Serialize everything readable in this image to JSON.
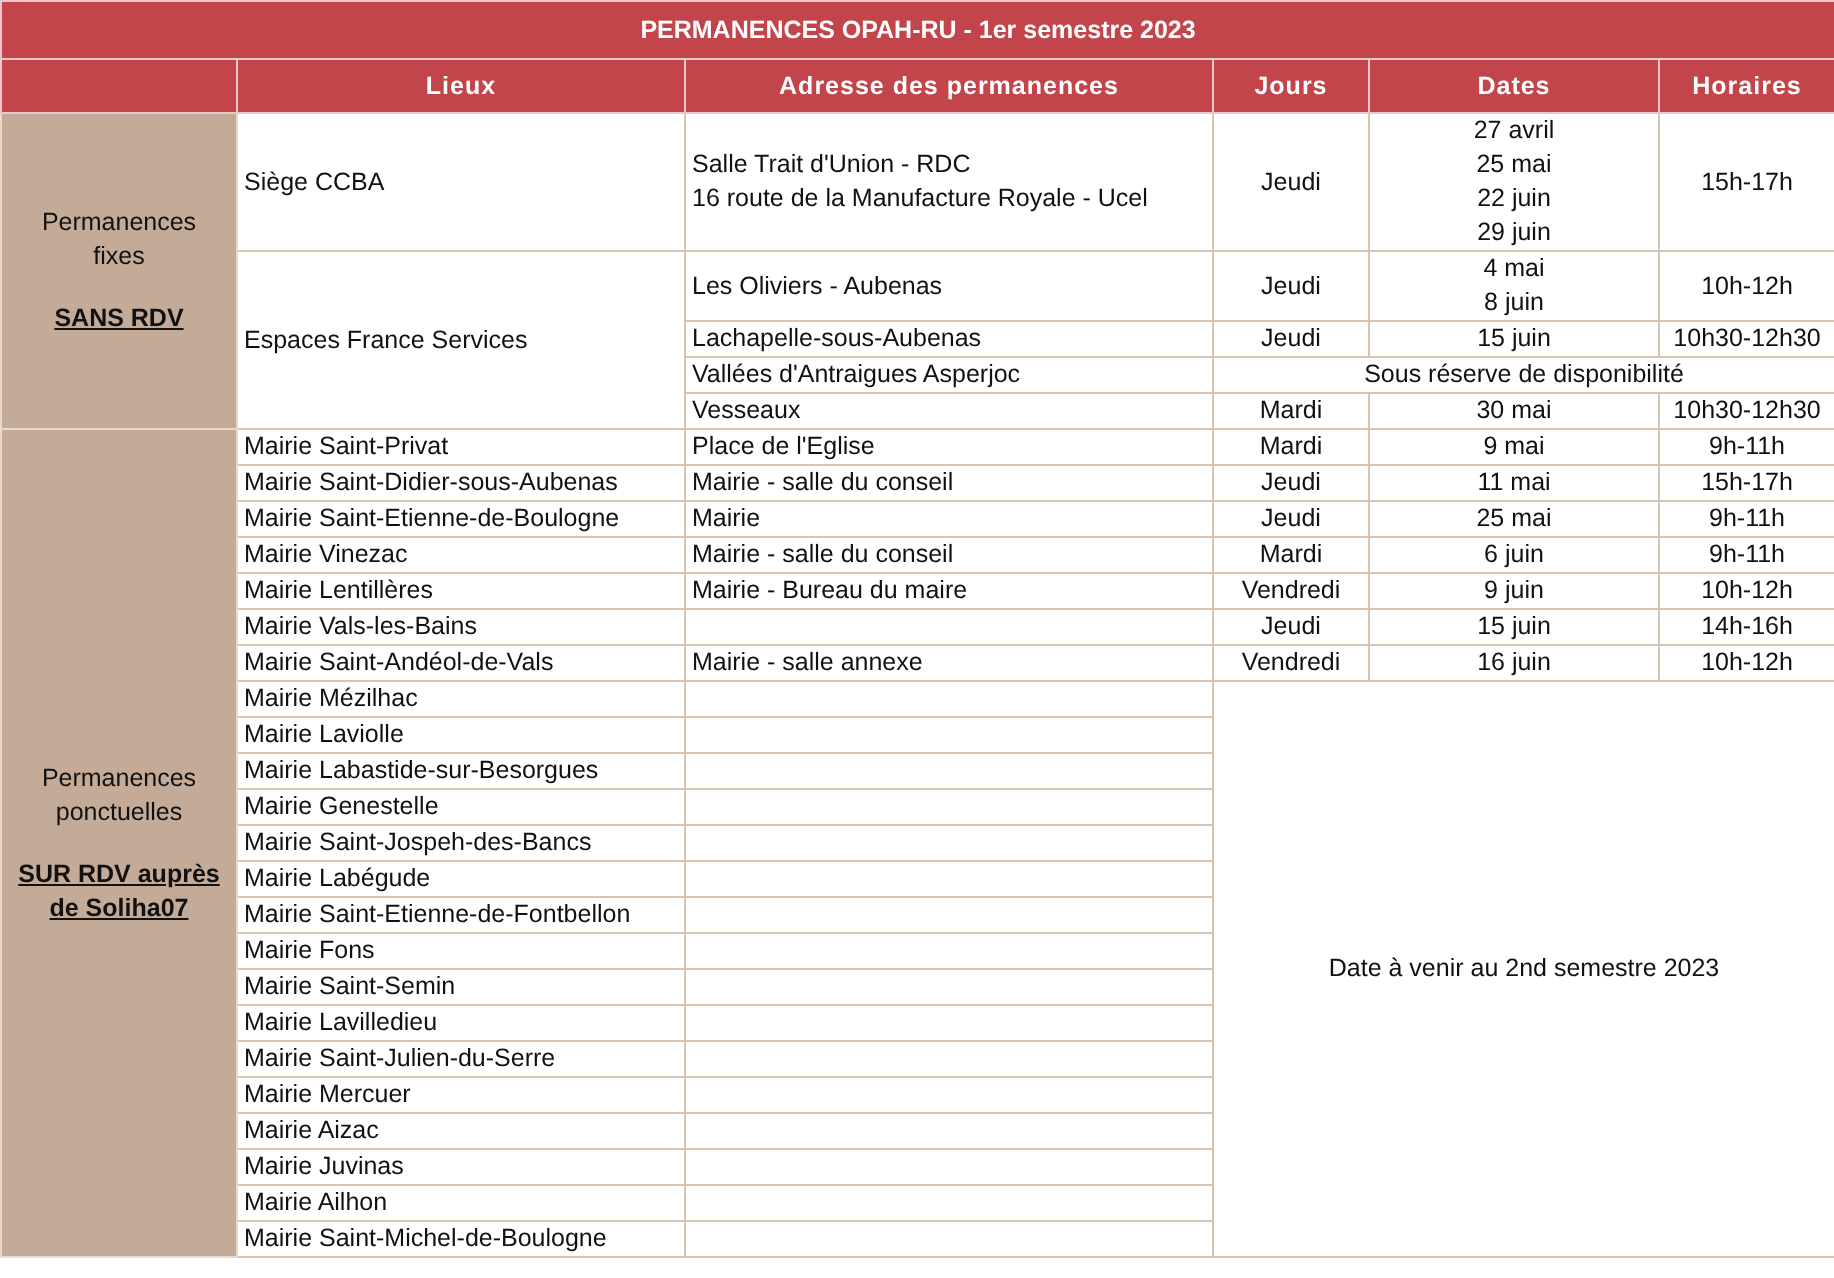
{
  "title": "PERMANENCES OPAH-RU  - 1er semestre 2023",
  "columns": [
    "Lieux",
    "Adresse des permanences",
    "Jours",
    "Dates",
    "Horaires"
  ],
  "sections": [
    {
      "label": "Permanences fixes",
      "note": "SANS RDV",
      "groups": [
        {
          "lieu": "Siège CCBA",
          "entries": [
            {
              "kind": "scheduled",
              "adresse": [
                "Salle Trait d'Union - RDC",
                "16 route de la Manufacture Royale - Ucel"
              ],
              "jours": "Jeudi",
              "dates": [
                "27 avril",
                "25 mai",
                "22 juin",
                "29 juin"
              ],
              "horaires": "15h-17h"
            }
          ]
        },
        {
          "lieu": "Espaces France Services",
          "entries": [
            {
              "kind": "scheduled",
              "adresse": [
                "Les Oliviers - Aubenas"
              ],
              "jours": "Jeudi",
              "dates": [
                "4 mai",
                "8 juin"
              ],
              "horaires": "10h-12h"
            },
            {
              "kind": "scheduled",
              "adresse": [
                "Lachapelle-sous-Aubenas"
              ],
              "jours": "Jeudi",
              "dates": [
                "15 juin"
              ],
              "horaires": "10h30-12h30"
            },
            {
              "kind": "reserve",
              "adresse": [
                "Vallées d'Antraigues Asperjoc"
              ],
              "note": "Sous réserve de disponibilité"
            },
            {
              "kind": "scheduled",
              "adresse": [
                "Vesseaux"
              ],
              "jours": "Mardi",
              "dates": [
                "30 mai"
              ],
              "horaires": "10h30-12h30"
            }
          ]
        }
      ]
    },
    {
      "label": "Permanences ponctuelles",
      "note": "SUR RDV auprès de Soliha07",
      "pending_note": "Date à venir au 2nd semestre 2023",
      "groups": [
        {
          "lieu": "Mairie Saint-Privat",
          "entries": [
            {
              "kind": "scheduled",
              "adresse": [
                "Place de l'Eglise"
              ],
              "jours": "Mardi",
              "dates": [
                "9 mai"
              ],
              "horaires": "9h-11h"
            }
          ]
        },
        {
          "lieu": "Mairie Saint-Didier-sous-Aubenas",
          "entries": [
            {
              "kind": "scheduled",
              "adresse": [
                "Mairie - salle du conseil"
              ],
              "jours": "Jeudi",
              "dates": [
                "11 mai"
              ],
              "horaires": "15h-17h"
            }
          ]
        },
        {
          "lieu": "Mairie Saint-Etienne-de-Boulogne",
          "entries": [
            {
              "kind": "scheduled",
              "adresse": [
                "Mairie"
              ],
              "jours": "Jeudi",
              "dates": [
                "25 mai"
              ],
              "horaires": "9h-11h"
            }
          ]
        },
        {
          "lieu": "Mairie Vinezac",
          "entries": [
            {
              "kind": "scheduled",
              "adresse": [
                "Mairie - salle du conseil"
              ],
              "jours": "Mardi",
              "dates": [
                "6 juin"
              ],
              "horaires": "9h-11h"
            }
          ]
        },
        {
          "lieu": "Mairie Lentillères",
          "entries": [
            {
              "kind": "scheduled",
              "adresse": [
                "Mairie - Bureau du maire"
              ],
              "jours": "Vendredi",
              "dates": [
                "9 juin"
              ],
              "horaires": "10h-12h"
            }
          ]
        },
        {
          "lieu": "Mairie Vals-les-Bains",
          "entries": [
            {
              "kind": "scheduled",
              "jours": "Jeudi",
              "dates": [
                "15 juin"
              ],
              "horaires": "14h-16h"
            }
          ]
        },
        {
          "lieu": "Mairie Saint-Andéol-de-Vals",
          "entries": [
            {
              "kind": "scheduled",
              "adresse": [
                "Mairie - salle annexe"
              ],
              "jours": "Vendredi",
              "dates": [
                "16 juin"
              ],
              "horaires": "10h-12h"
            }
          ]
        },
        {
          "lieu": "Mairie Mézilhac",
          "entries": [
            {
              "kind": "pending"
            }
          ]
        },
        {
          "lieu": "Mairie Laviolle",
          "entries": [
            {
              "kind": "pending"
            }
          ]
        },
        {
          "lieu": "Mairie Labastide-sur-Besorgues",
          "entries": [
            {
              "kind": "pending"
            }
          ]
        },
        {
          "lieu": "Mairie Genestelle",
          "entries": [
            {
              "kind": "pending"
            }
          ]
        },
        {
          "lieu": "Mairie Saint-Jospeh-des-Bancs",
          "entries": [
            {
              "kind": "pending"
            }
          ]
        },
        {
          "lieu": "Mairie Labégude",
          "entries": [
            {
              "kind": "pending"
            }
          ]
        },
        {
          "lieu": "Mairie Saint-Etienne-de-Fontbellon",
          "entries": [
            {
              "kind": "pending"
            }
          ]
        },
        {
          "lieu": "Mairie Fons",
          "entries": [
            {
              "kind": "pending"
            }
          ]
        },
        {
          "lieu": "Mairie Saint-Semin",
          "entries": [
            {
              "kind": "pending"
            }
          ]
        },
        {
          "lieu": "Mairie Lavilledieu",
          "entries": [
            {
              "kind": "pending"
            }
          ]
        },
        {
          "lieu": "Mairie Saint-Julien-du-Serre",
          "entries": [
            {
              "kind": "pending"
            }
          ]
        },
        {
          "lieu": "Mairie Mercuer",
          "entries": [
            {
              "kind": "pending"
            }
          ]
        },
        {
          "lieu": "Mairie Aizac",
          "entries": [
            {
              "kind": "pending"
            }
          ]
        },
        {
          "lieu": "Mairie Juvinas",
          "entries": [
            {
              "kind": "pending"
            }
          ]
        },
        {
          "lieu": "Mairie Ailhon",
          "entries": [
            {
              "kind": "pending"
            }
          ]
        },
        {
          "lieu": "Mairie Saint-Michel-de-Boulogne",
          "entries": [
            {
              "kind": "pending"
            }
          ]
        }
      ]
    }
  ]
}
